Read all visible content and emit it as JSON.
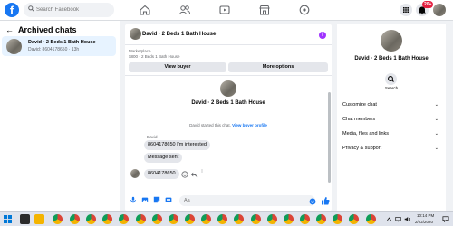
{
  "topbar": {
    "logo_text": "f",
    "search_placeholder": "Search Facebook",
    "notification_badge": "20+"
  },
  "left": {
    "title": "Archived chats",
    "conversation": {
      "name": "David · 2 Beds 1 Bath House",
      "subtitle": "David: 8604178650 · 13h"
    }
  },
  "chat": {
    "header_title": "David · 2 Beds 1 Bath House",
    "marketplace_label": "Marketplace",
    "marketplace_price": "$800 · 2 Beds 1 Bath House",
    "view_buyer_label": "View buyer",
    "more_options_label": "More options",
    "title": "David · 2 Beds 1 Bath House",
    "started_text": "David started this chat.",
    "view_buyer_profile_link": "View buyer profile",
    "sender_name": "David",
    "messages": [
      "8604178650 I'm interested",
      "Message sent",
      "8604178650"
    ],
    "composer_placeholder": "Aa"
  },
  "details": {
    "name": "David · 2 Beds 1 Bath House",
    "search_label": "Search",
    "sections": [
      "Customize chat",
      "Chat members",
      "Media, files and links",
      "Privacy & support"
    ]
  },
  "taskbar": {
    "time": "10:14 PM",
    "date": "2/22/2020"
  },
  "colors": {
    "brand_blue": "#1877f2",
    "selected_bg": "#e7f3ff",
    "badge_red": "#e41e3f",
    "info_purple": "#a033ff"
  }
}
